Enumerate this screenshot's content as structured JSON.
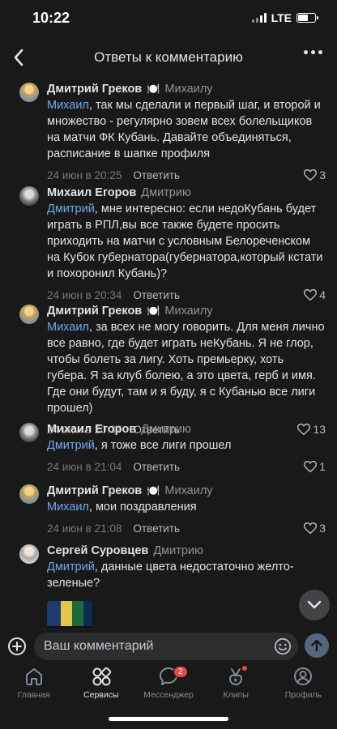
{
  "status": {
    "time": "10:22",
    "network": "LTE"
  },
  "header": {
    "title": "Ответы к комментарию"
  },
  "comments": [
    {
      "author": "Дмитрий Греков",
      "emoji": "🍽️",
      "to": "Михаилу",
      "mention": "Михаил",
      "text": ", так мы сделали и первый шаг, и второй и множество - регулярно зовем всех болельщиков на матчи ФК Кубань. Давайте объединяться, расписание в шапке профиля",
      "date": "24 июн в 20:25",
      "reply": "Ответить",
      "likes": "3"
    },
    {
      "author": "Михаил Егоров",
      "emoji": "",
      "to": "Дмитрию",
      "mention": "Дмитрий",
      "text": ", мне интересно: если недоКубань будет играть в РПЛ,вы все также будете просить приходить на матчи с условным Белореченском на Кубок губернатора(губернатора,который кстати и похоронил Кубань)?",
      "date": "24 июн в 20:34",
      "reply": "Ответить",
      "likes": "4"
    },
    {
      "author": "Дмитрий Греков",
      "emoji": "🍽️",
      "to": "Михаилу",
      "mention": "Михаил",
      "text": ", за всех не могу говорить. Для меня лично все равно, где будет играть неКубань. Я не глор, чтобы болеть за лигу. Хоть премьерку, хоть губера. Я за клуб болею, а это цвета, герб и имя. Где они будут, там и я буду, я с Кубанью все лиги прошел)",
      "date": "24 июн в 20:37",
      "reply": "Ответить",
      "likes": "13"
    },
    {
      "author": "Михаил Егоров",
      "emoji": "",
      "to": "Дмитрию",
      "mention": "Дмитрий",
      "text": ", я тоже все лиги прошел",
      "date": "24 июн в 21:04",
      "reply": "Ответить",
      "likes": "1"
    },
    {
      "author": "Дмитрий Греков",
      "emoji": "🍽️",
      "to": "Михаилу",
      "mention": "Михаил",
      "text": ", мои поздравления",
      "date": "24 июн в 21:08",
      "reply": "Ответить",
      "likes": "3"
    },
    {
      "author": "Сергей Суровцев",
      "emoji": "",
      "to": "Дмитрию",
      "mention": "Дмитрий",
      "text": ", данные цвета недостаточно желто-зеленые?",
      "date": "",
      "reply": "",
      "likes": ""
    }
  ],
  "composer": {
    "placeholder": "Ваш комментарий"
  },
  "tabs": [
    {
      "label": "Главная",
      "icon": "home-icon"
    },
    {
      "label": "Сервисы",
      "icon": "services-icon"
    },
    {
      "label": "Мессенджер",
      "icon": "messenger-icon",
      "badge": "2"
    },
    {
      "label": "Клипы",
      "icon": "clips-icon"
    },
    {
      "label": "Профиль",
      "icon": "profile-icon"
    }
  ],
  "colors": {
    "background": "#19191a",
    "mention": "#71aaeb",
    "badge": "#e64646"
  }
}
